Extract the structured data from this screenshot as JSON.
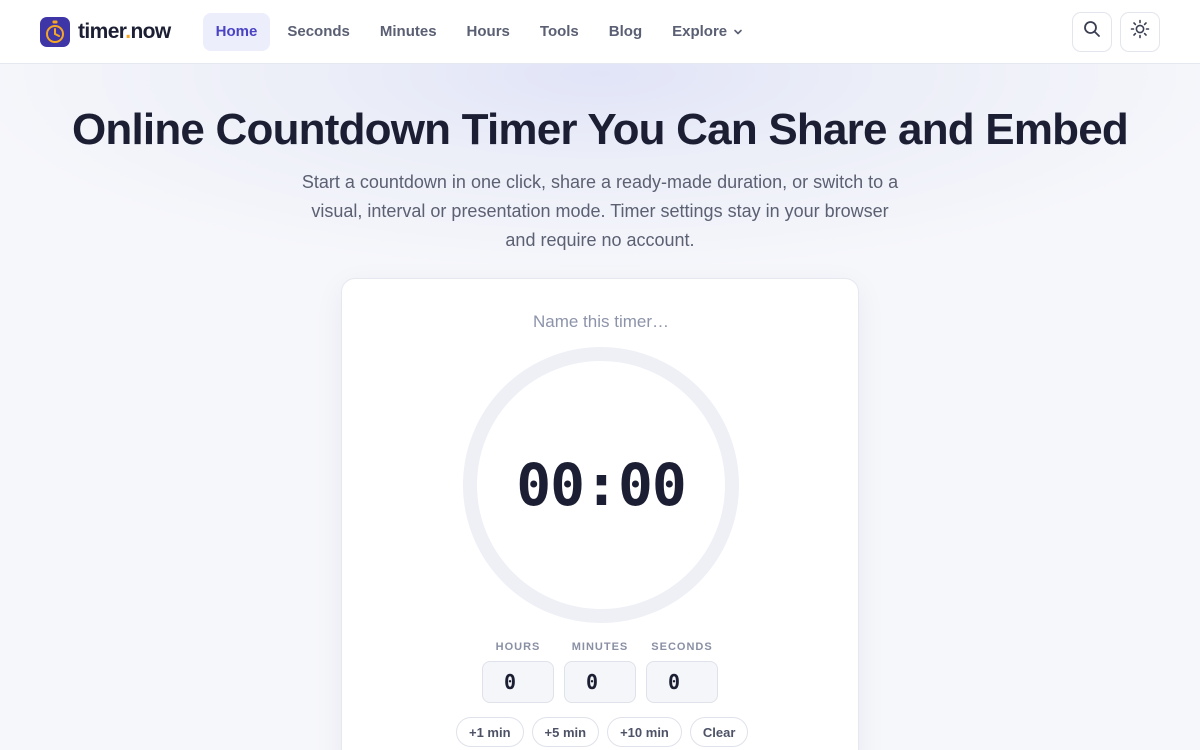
{
  "brand": {
    "name_part1": "timer",
    "name_dot": ".",
    "name_part2": "now",
    "accent": "#4a43c4",
    "logo_bg": "#3e35a6",
    "dot_color": "#f5a623"
  },
  "nav": {
    "items": [
      {
        "label": "Home",
        "active": true
      },
      {
        "label": "Seconds"
      },
      {
        "label": "Minutes"
      },
      {
        "label": "Hours"
      },
      {
        "label": "Tools"
      },
      {
        "label": "Blog"
      },
      {
        "label": "Explore",
        "icon": "chevron-down-icon"
      }
    ]
  },
  "header_actions": {
    "search_icon": "search-icon",
    "theme_icon": "sun-icon"
  },
  "hero": {
    "title": "Online Countdown Timer You Can Share and Embed",
    "subtitle": "Start a countdown in one click, share a ready-made duration, or switch to a visual, interval or presentation mode. Timer settings stay in your browser and require no account."
  },
  "timer": {
    "name_placeholder": "Name this timer…",
    "display": "00:00",
    "fields": [
      {
        "label": "HOURS",
        "value": "0"
      },
      {
        "label": "MINUTES",
        "value": "0"
      },
      {
        "label": "SECONDS",
        "value": "0"
      }
    ],
    "quick_actions": [
      "+1 min",
      "+5 min",
      "+10 min",
      "Clear"
    ]
  }
}
